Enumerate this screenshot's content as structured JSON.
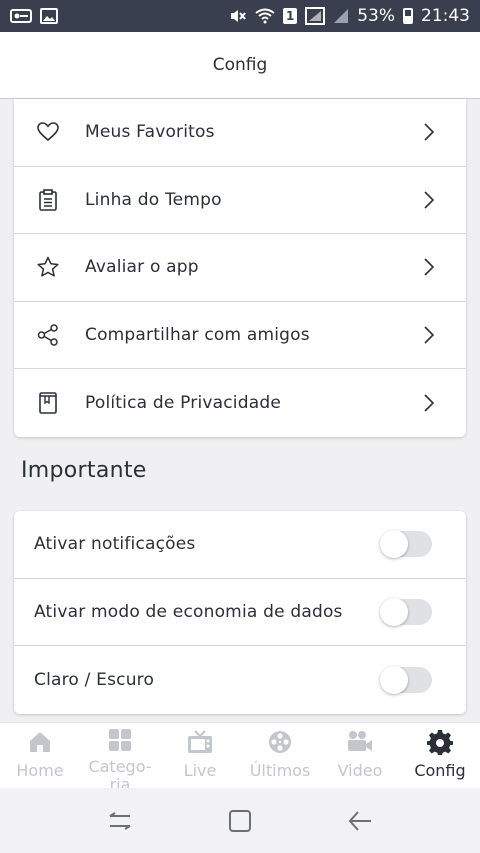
{
  "status_bar": {
    "battery": "53%",
    "time": "21:43",
    "sim_badge": "1"
  },
  "header": {
    "title": "Config"
  },
  "menu": {
    "items": [
      {
        "label": "Meus Favoritos",
        "icon": "heart-icon"
      },
      {
        "label": "Linha do Tempo",
        "icon": "clipboard-icon"
      },
      {
        "label": "Avaliar o app",
        "icon": "star-icon"
      },
      {
        "label": "Compartilhar com amigos",
        "icon": "share-icon"
      },
      {
        "label": "Política de Privacidade",
        "icon": "book-icon"
      }
    ]
  },
  "important": {
    "title": "Importante",
    "toggles": [
      {
        "label": "Ativar notificações",
        "on": false
      },
      {
        "label": "Ativar modo de economia de dados",
        "on": false
      },
      {
        "label": "Claro / Escuro",
        "on": false
      }
    ]
  },
  "tabs": [
    {
      "label": "Home",
      "icon": "home-icon",
      "active": false
    },
    {
      "label": "Catego-\nria",
      "icon": "grid-icon",
      "active": false
    },
    {
      "label": "Live",
      "icon": "tv-icon",
      "active": false
    },
    {
      "label": "Últimos",
      "icon": "film-reel-icon",
      "active": false
    },
    {
      "label": "Video",
      "icon": "video-camera-icon",
      "active": false
    },
    {
      "label": "Config",
      "icon": "gear-icon",
      "active": true
    }
  ],
  "colors": {
    "status_bar": "#3a3f4f",
    "text": "#2b2f3a",
    "inactive_tab": "#c3c6cd",
    "background": "#f0f0f2"
  }
}
